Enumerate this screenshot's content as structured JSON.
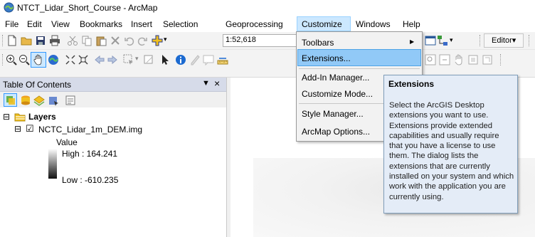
{
  "window": {
    "title": "NTCT_Lidar_Short_Course - ArcMap"
  },
  "menubar": {
    "items": [
      "File",
      "Edit",
      "View",
      "Bookmarks",
      "Insert",
      "Selection",
      "Geoprocessing",
      "Customize",
      "Windows",
      "Help"
    ],
    "active": "Customize"
  },
  "toolbar": {
    "scale": "1:52,618",
    "editor_label": "Editor▾"
  },
  "customize_menu": {
    "items": [
      "Toolbars",
      "Extensions...",
      "Add-In Manager...",
      "Customize Mode...",
      "Style Manager...",
      "ArcMap Options..."
    ],
    "highlighted": "Extensions...",
    "submenu_arrow": "▶"
  },
  "tooltip": {
    "title": "Extensions",
    "body": "Select the ArcGIS Desktop extensions you want to use. Extensions provide extended capabilities and usually require that you have a license to use them. The dialog lists the extensions that are currently installed on your system and which work with the application you are currently using."
  },
  "toc": {
    "title": "Table Of Contents",
    "pin": "⁴",
    "close": "×",
    "layers_label": "Layers",
    "layer_name": "NCTC_Lidar_1m_DEM.img",
    "value_label": "Value",
    "high_label": "High : 164.241",
    "low_label": "Low : -610.235",
    "expander_symbol": "⊟",
    "checkbox_symbol": "☑"
  },
  "colors": {
    "menu_highlight": "#91c9f7",
    "tooltip_bg": "#e4ecf7",
    "toc_header": "#d6dbe9"
  }
}
